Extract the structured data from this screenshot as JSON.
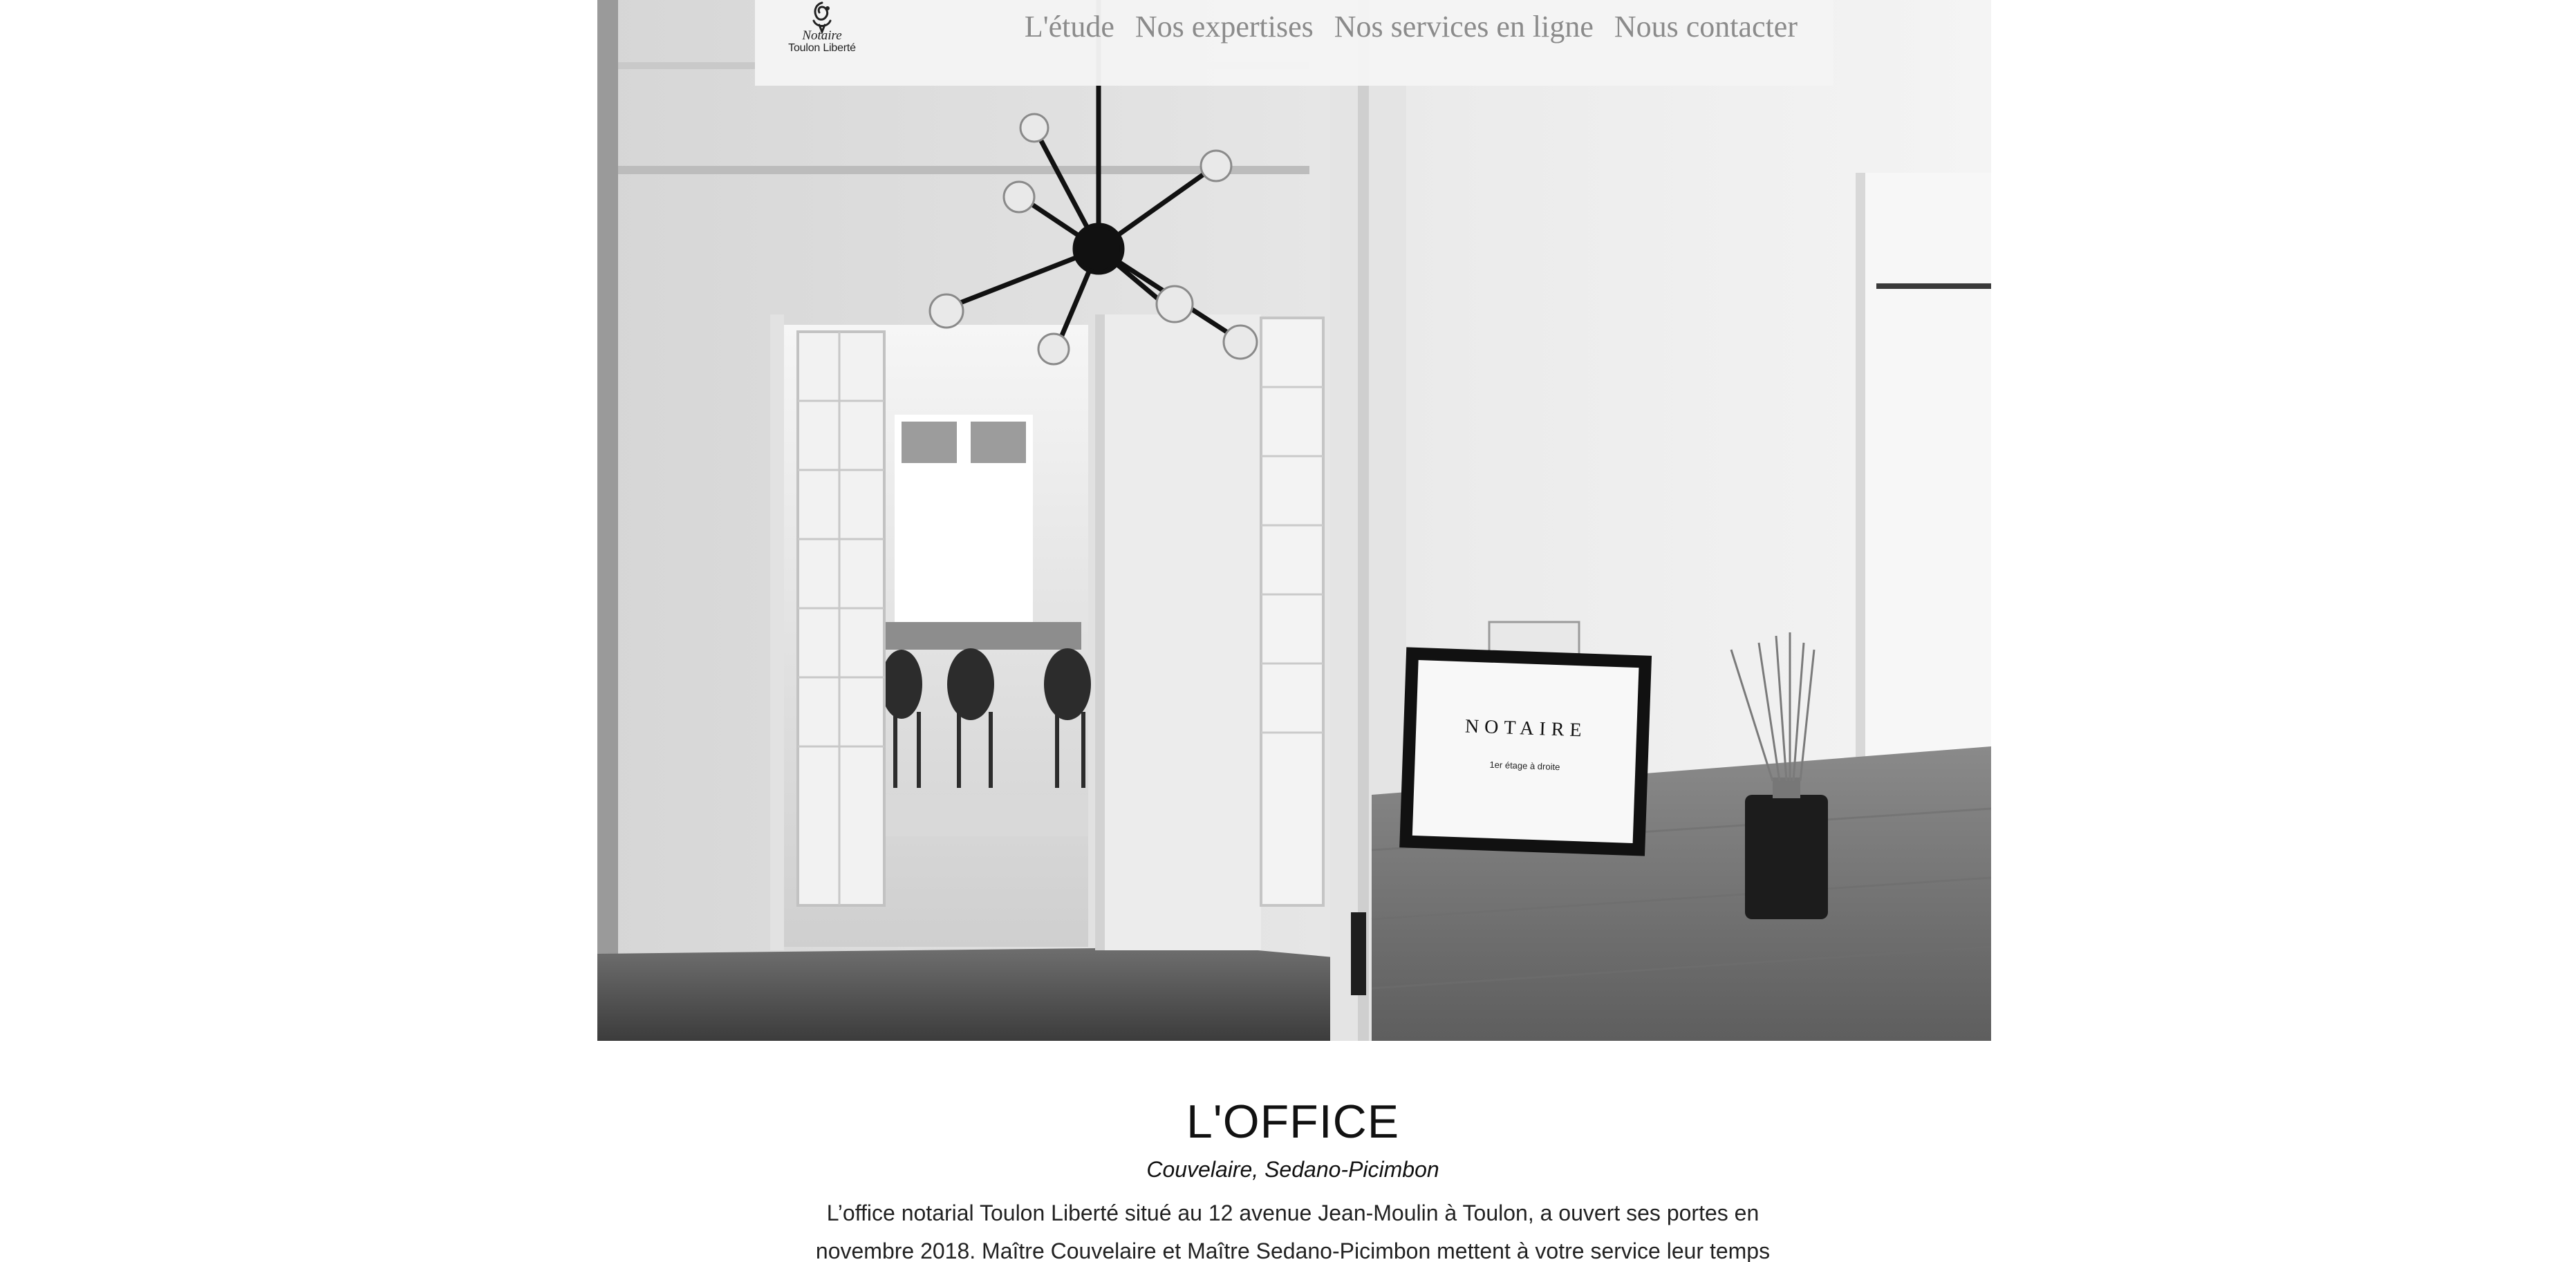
{
  "header": {
    "logo": {
      "script": "Notaire",
      "place": "Toulon Liberté",
      "icon": "notaire-seal-icon"
    },
    "nav": [
      {
        "label": "L'étude"
      },
      {
        "label": "Nos expertises"
      },
      {
        "label": "Nos services en ligne"
      },
      {
        "label": "Nous contacter"
      }
    ]
  },
  "hero": {
    "sign_title": "NOTAIRE",
    "sign_subtitle": "1er étage à droite"
  },
  "content": {
    "title": "L'OFFICE",
    "subtitle": "Couvelaire, Sedano-Picimbon",
    "body": "L’office notarial Toulon Liberté situé au 12 avenue Jean-Moulin à Toulon, a ouvert ses portes en novembre 2018. Maître Couvelaire et Maître Sedano-Picimbon mettent à votre service leur temps et"
  },
  "colors": {
    "header_bg": "#f4f4f4",
    "nav_text": "#8b8b8b",
    "title_text": "#111111"
  }
}
